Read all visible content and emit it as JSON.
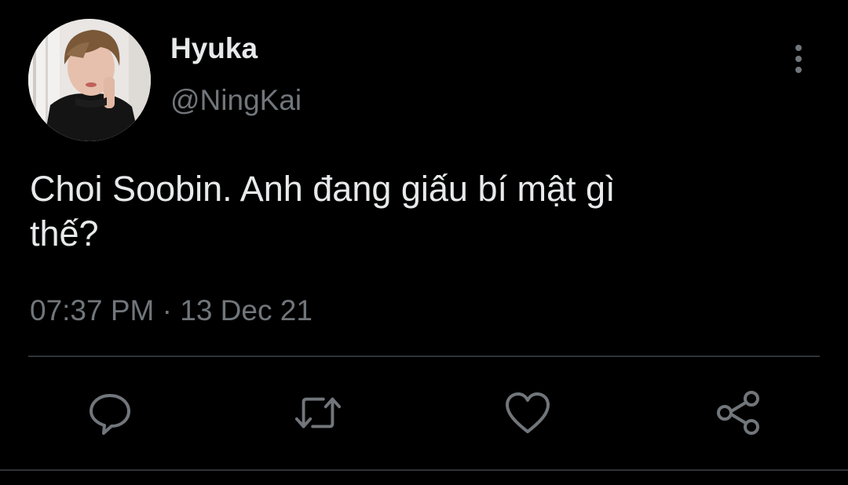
{
  "tweet": {
    "author": {
      "display_name": "Hyuka",
      "handle": "@NingKai",
      "avatar_icon": "profile-photo"
    },
    "text_line1": "Choi Soobin. Anh đang giấu bí mật gì",
    "text_line2": "thế?",
    "timestamp": "07:37 PM · 13 Dec 21",
    "actions": {
      "reply_icon": "reply-icon",
      "retweet_icon": "retweet-icon",
      "like_icon": "heart-icon",
      "share_icon": "share-icon"
    }
  },
  "theme": {
    "background": "#000000",
    "primary_text": "#e7e9ea",
    "secondary_text": "#71767b",
    "divider": "#2f3336"
  }
}
